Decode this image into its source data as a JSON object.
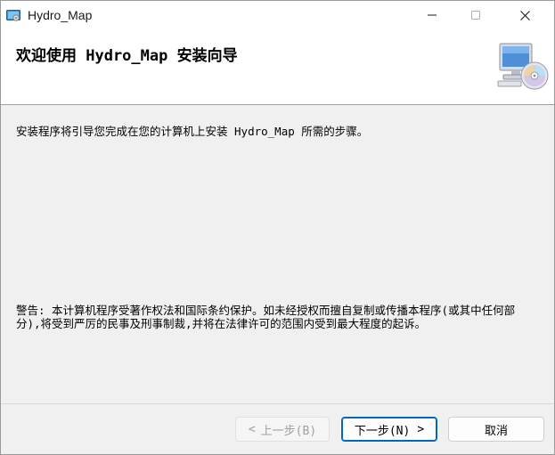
{
  "window": {
    "title": "Hydro_Map",
    "controls": {
      "minimize_icon": "minimize-icon",
      "maximize_icon": "maximize-icon",
      "close_icon": "close-icon"
    }
  },
  "header": {
    "title": "欢迎使用 Hydro_Map 安装向导",
    "icon": "computer-disc-icon"
  },
  "body": {
    "intro": "安装程序将引导您完成在您的计算机上安装 Hydro_Map 所需的步骤。",
    "warning": "警告: 本计算机程序受著作权法和国际条约保护。如未经授权而擅自复制或传播本程序(或其中任何部分),将受到严厉的民事及刑事制裁,并将在法律许可的范围内受到最大程度的起诉。"
  },
  "buttons": {
    "back_label": "上一步(B)",
    "back_glyph": "<",
    "back_enabled": false,
    "next_label": "下一步(N)",
    "next_glyph": ">",
    "cancel_label": "取消"
  },
  "colors": {
    "accent": "#0067c0",
    "body_bg": "#f0f0f0",
    "banner_bg": "#ffffff"
  }
}
